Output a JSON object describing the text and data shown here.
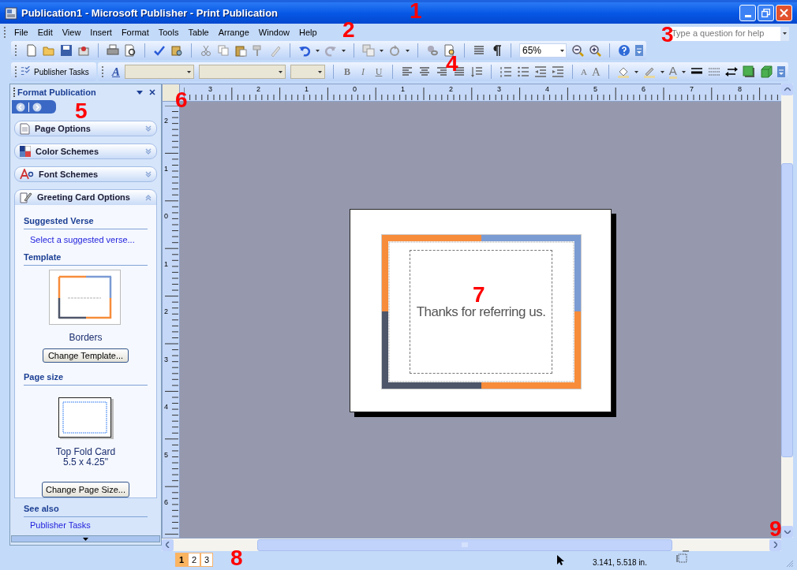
{
  "window": {
    "title": "Publication1 - Microsoft Publisher - Print Publication"
  },
  "menu": [
    {
      "label": "File"
    },
    {
      "label": "Edit"
    },
    {
      "label": "View"
    },
    {
      "label": "Insert"
    },
    {
      "label": "Format"
    },
    {
      "label": "Tools"
    },
    {
      "label": "Table"
    },
    {
      "label": "Arrange"
    },
    {
      "label": "Window"
    },
    {
      "label": "Help"
    }
  ],
  "help_box": {
    "placeholder": "Type a question for help"
  },
  "zoom": {
    "value": "65%"
  },
  "task_button": {
    "label": "Publisher Tasks"
  },
  "format_toolbar": {
    "style_glyph": "A",
    "bold": "B",
    "italic": "I",
    "underline": "U",
    "shrink_glyph": "A",
    "grow_glyph": "A",
    "font_color_glyph": "A"
  },
  "task_pane": {
    "title": "Format Publication",
    "sections": [
      {
        "label": "Page Options",
        "expanded": false
      },
      {
        "label": "Color Schemes",
        "expanded": false
      },
      {
        "label": "Font Schemes",
        "expanded": false
      },
      {
        "label": "Greeting Card Options",
        "expanded": true
      }
    ],
    "suggested_verse": {
      "heading": "Suggested Verse",
      "link": "Select a suggested verse..."
    },
    "template": {
      "heading": "Template",
      "caption": "Borders",
      "button": "Change Template..."
    },
    "page_size": {
      "heading": "Page size",
      "caption": "Top Fold Card",
      "dimensions": "5.5 x 4.25\"",
      "button": "Change Page Size..."
    },
    "see_also": {
      "heading": "See also",
      "link": "Publisher Tasks"
    }
  },
  "rulers": {
    "horizontal": [
      "3",
      "2",
      "1",
      "0",
      "1",
      "2",
      "3",
      "4",
      "5",
      "6",
      "7",
      "8"
    ],
    "vertical": [
      "2",
      "1",
      "0",
      "1",
      "2",
      "3",
      "4",
      "5",
      "6"
    ]
  },
  "page": {
    "text": "Thanks for referring us."
  },
  "page_tabs": [
    {
      "label": "1",
      "selected": true
    },
    {
      "label": "2",
      "selected": false
    },
    {
      "label": "3",
      "selected": false
    }
  ],
  "status": {
    "position": "3.141, 5.518 in."
  },
  "callouts": [
    "1",
    "2",
    "3",
    "4",
    "5",
    "6",
    "7",
    "8",
    "9"
  ]
}
